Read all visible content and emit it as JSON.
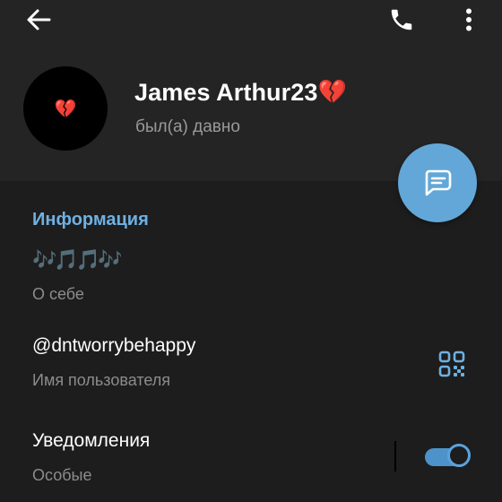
{
  "profile": {
    "name": "James Arthur23",
    "name_emoji": "💔",
    "status": "был(а) давно",
    "avatar_emoji": "💔"
  },
  "info": {
    "section_title": "Информация",
    "bio": {
      "value": "🎶🎵🎵🎶",
      "label": "О себе"
    },
    "username": {
      "value": "@dntworrybehappy",
      "label": "Имя пользователя"
    },
    "notifications": {
      "value": "Уведомления",
      "label": "Особые",
      "enabled": true
    }
  },
  "icons": {
    "back": "arrow-left-icon",
    "call": "phone-icon",
    "menu": "more-vertical-icon",
    "fab": "message-icon",
    "qr": "qr-code-icon"
  },
  "colors": {
    "accent": "#63a7d8",
    "section_title": "#6eb1e3",
    "header_bg": "#242424",
    "content_bg": "#1d1d1d"
  }
}
